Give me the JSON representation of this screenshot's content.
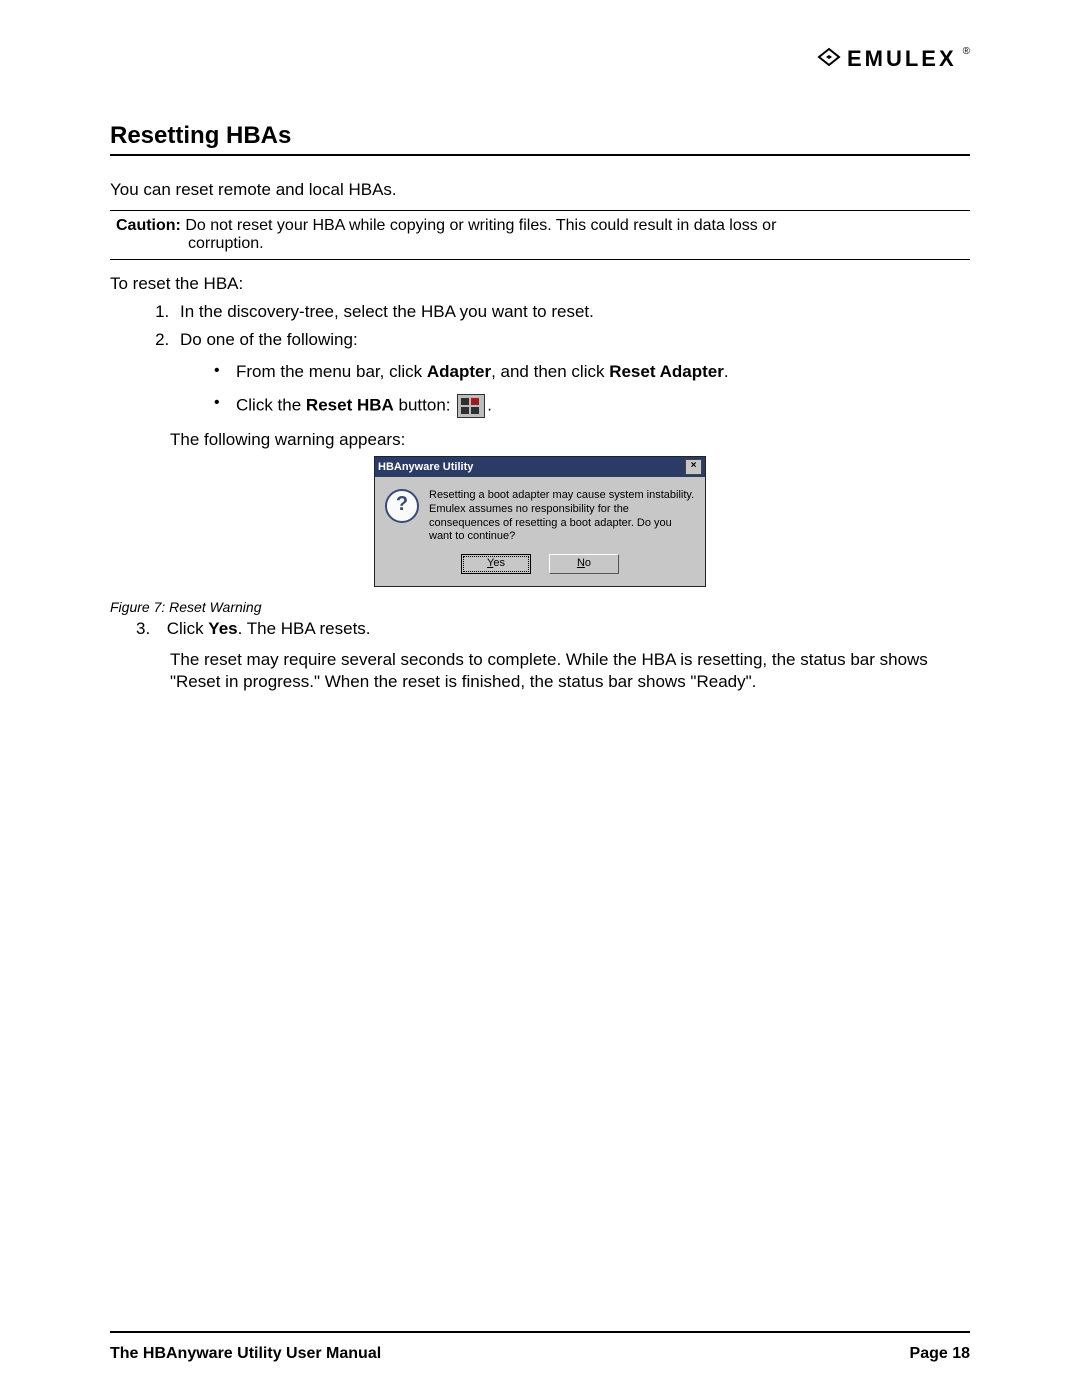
{
  "brand": {
    "logo_text": "EMULEX",
    "registered": "®"
  },
  "heading": "Resetting HBAs",
  "intro": "You can reset remote and local HBAs.",
  "caution": {
    "label": "Caution:",
    "line1": " Do not reset your HBA while copying or writing files. This could result in data loss or",
    "line2": "corruption."
  },
  "lead": "To reset the HBA:",
  "steps": {
    "s1": "In the discovery-tree, select the HBA you want to reset.",
    "s2": "Do one of the following:",
    "s2_bullets": {
      "b1_pre": "From the menu bar, click ",
      "b1_bold1": "Adapter",
      "b1_mid": ", and then click ",
      "b1_bold2": "Reset Adapter",
      "b1_post": ".",
      "b2_pre": "Click the ",
      "b2_bold": "Reset HBA",
      "b2_mid": " button: ",
      "b2_post": "."
    },
    "s2_after": "The following warning appears:",
    "s3_num": "3.",
    "s3_pre": " Click ",
    "s3_bold": "Yes",
    "s3_post": ". The HBA resets.",
    "s3_body": "The reset may require several seconds to complete. While the HBA is resetting, the status bar shows \"Reset in progress.\" When the reset is finished, the status bar shows \"Ready\"."
  },
  "dialog": {
    "title": "HBAnyware Utility",
    "close": "×",
    "icon": "?",
    "message": "Resetting a boot adapter may cause system instability. Emulex assumes no responsibility for the consequences of resetting a boot adapter.  Do you want to continue?",
    "yes_u": "Y",
    "yes_rest": "es",
    "no_u": "N",
    "no_rest": "o"
  },
  "figure_caption": "Figure 7: Reset Warning",
  "footer": {
    "left": "The HBAnyware Utility User Manual",
    "right": "Page 18"
  }
}
